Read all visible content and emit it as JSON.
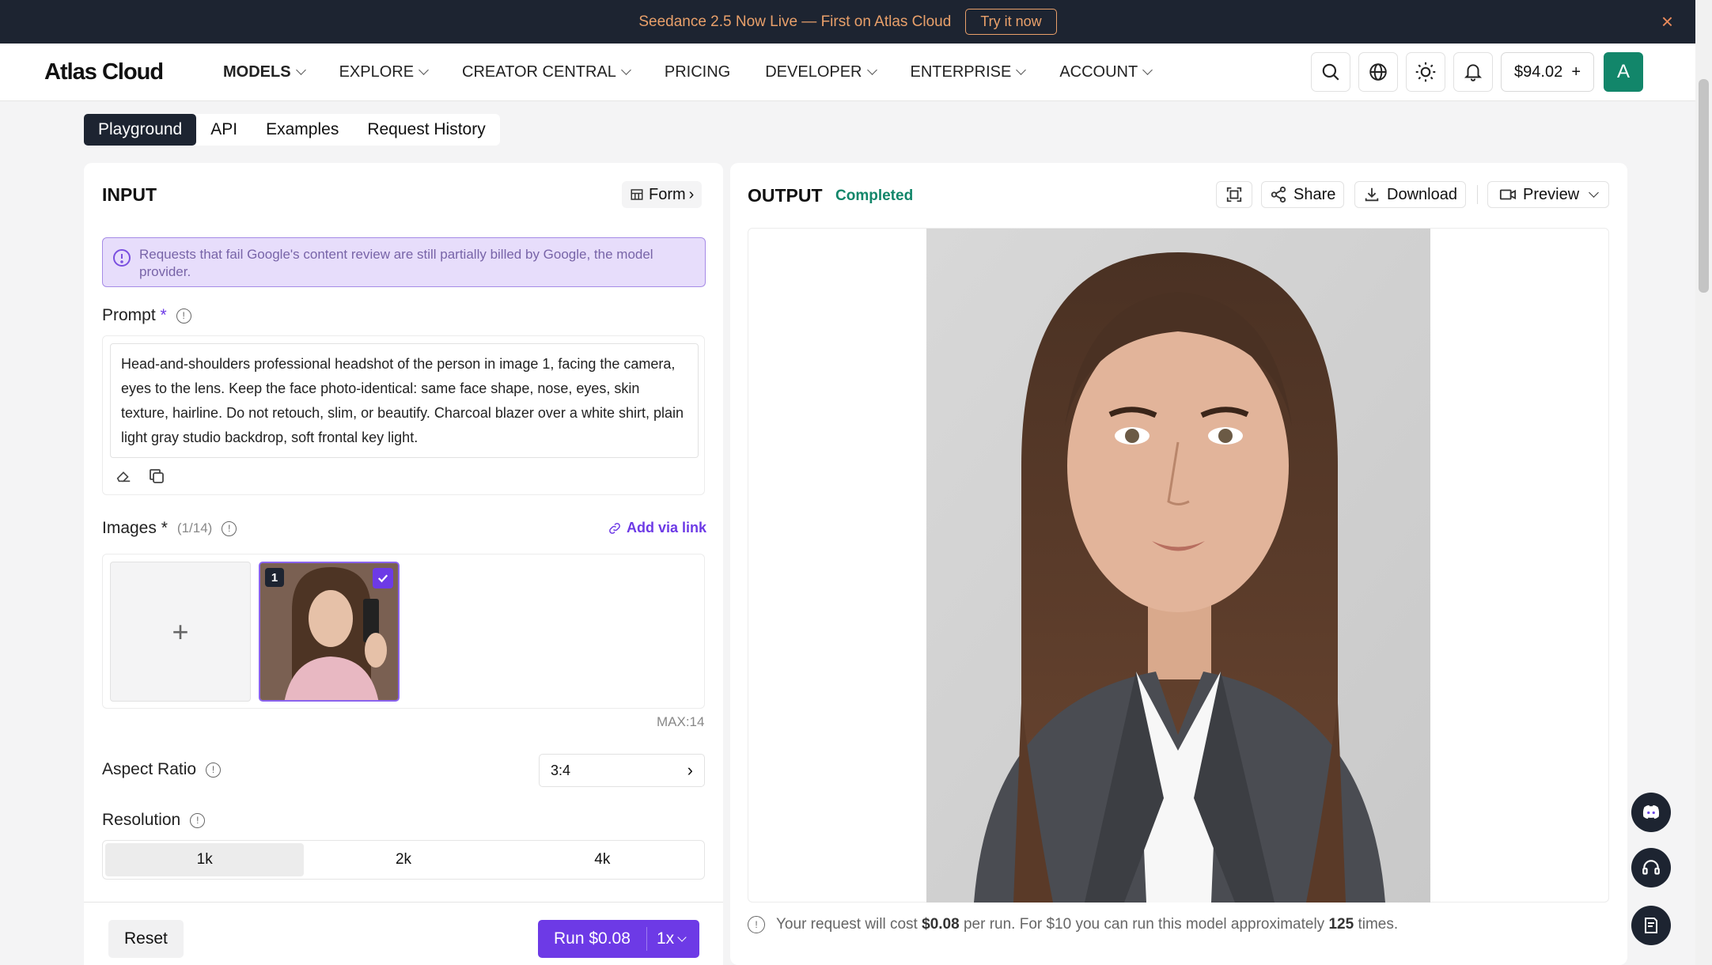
{
  "banner": {
    "text": "Seedance 2.5 Now Live — First on Atlas Cloud",
    "cta": "Try it now",
    "close": "×"
  },
  "nav": {
    "logo": "Atlas Cloud",
    "items": [
      {
        "label": "MODELS",
        "dropdown": true
      },
      {
        "label": "EXPLORE",
        "dropdown": true
      },
      {
        "label": "CREATOR CENTRAL",
        "dropdown": true
      },
      {
        "label": "PRICING",
        "dropdown": false
      },
      {
        "label": "DEVELOPER",
        "dropdown": true
      },
      {
        "label": "ENTERPRISE",
        "dropdown": true
      },
      {
        "label": "ACCOUNT",
        "dropdown": true
      }
    ],
    "balance": "$94.02",
    "balance_add": "+",
    "avatar": "A"
  },
  "tabs": [
    "Playground",
    "API",
    "Examples",
    "Request History"
  ],
  "input": {
    "title": "INPUT",
    "form_btn": "Form",
    "notice": "Requests that fail Google's content review are still partially billed by Google, the model provider.",
    "prompt_label": "Prompt",
    "required": "*",
    "prompt_text": "Head-and-shoulders professional headshot of the person in image 1, facing the camera, eyes to the lens. Keep the face photo-identical: same face shape, nose, eyes, skin texture, hairline. Do not retouch, slim, or beautify. Charcoal blazer over a white shirt, plain light gray studio backdrop, soft frontal key light.",
    "images_label": "Images",
    "images_count": "(1/14)",
    "add_link": "Add via link",
    "add_plus": "+",
    "thumb_index": "1",
    "max": "MAX:14",
    "aspect_label": "Aspect Ratio",
    "aspect_value": "3:4",
    "resolution_label": "Resolution",
    "resolutions": [
      "1k",
      "2k",
      "4k"
    ],
    "reset": "Reset",
    "run": "Run $0.08",
    "multiplier": "1x"
  },
  "output": {
    "title": "OUTPUT",
    "status": "Completed",
    "share": "Share",
    "download": "Download",
    "preview": "Preview",
    "cost_pre": "Your request will cost",
    "cost": "$0.08",
    "cost_mid": "per run. For $10 you can run this model approximately",
    "runs": "125",
    "cost_post": "times."
  },
  "colors": {
    "accent": "#6d3ae6",
    "success": "#12866a",
    "banner_bg": "#1d2431",
    "banner_text": "#e9a06a"
  }
}
